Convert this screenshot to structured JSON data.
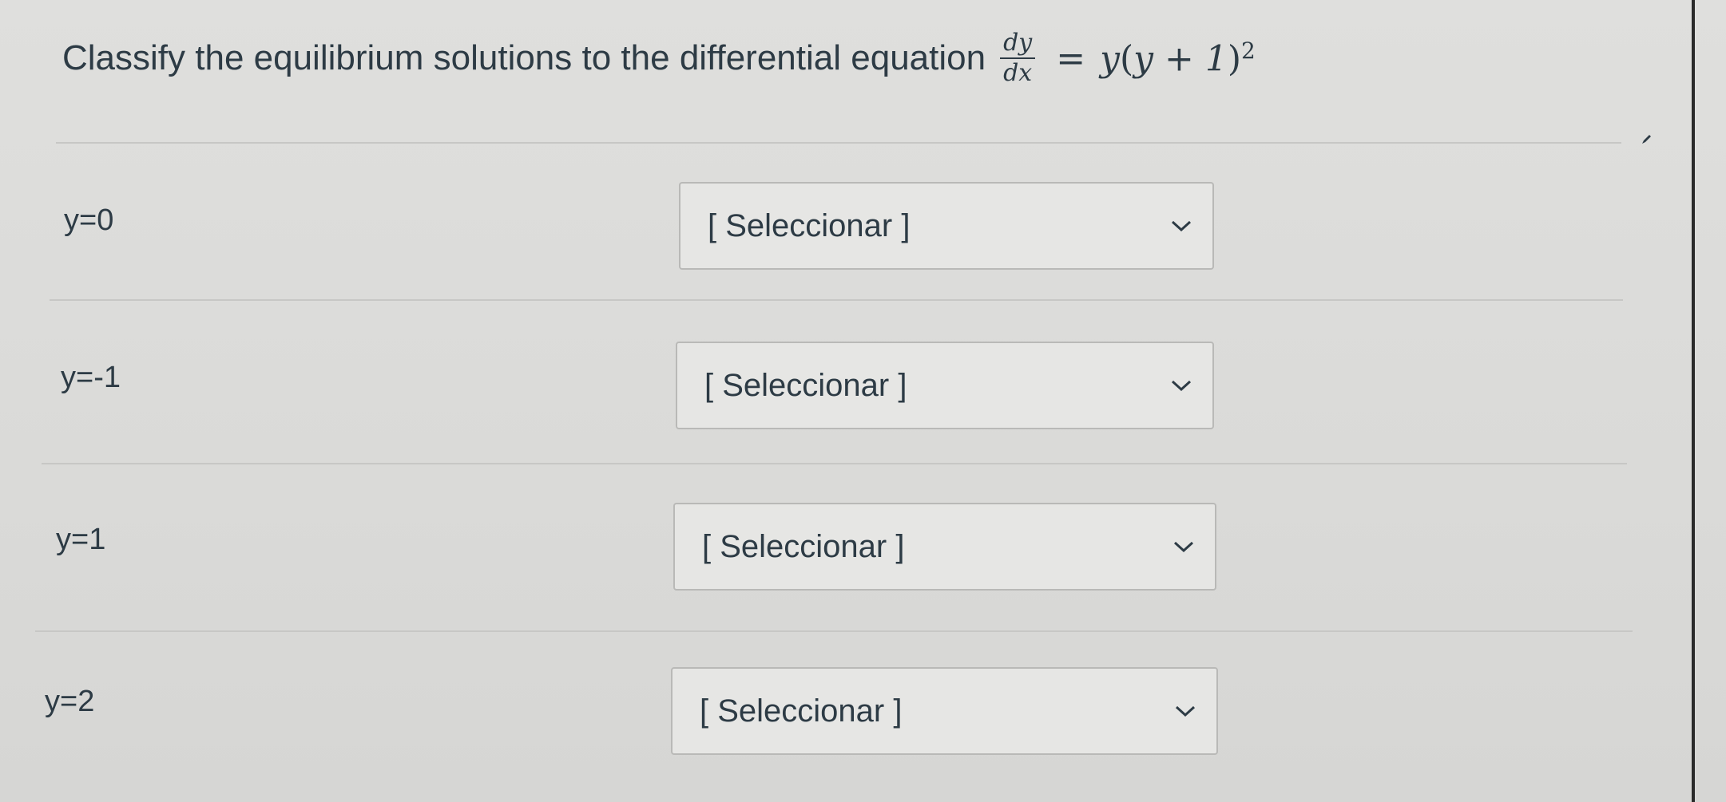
{
  "question": {
    "text": "Classify the equilibrium solutions to the differential equation",
    "equation": {
      "numerator": "dy",
      "denominator": "dx",
      "equals": "=",
      "rhs_y": "y",
      "rhs_open": "(",
      "rhs_inner": "y + 1",
      "rhs_close": ")",
      "rhs_exponent": "2"
    }
  },
  "rows": [
    {
      "label": "y=0",
      "select_value": "[ Seleccionar ]"
    },
    {
      "label": "y=-1",
      "select_value": "[ Seleccionar ]"
    },
    {
      "label": "y=1",
      "select_value": "[ Seleccionar ]"
    },
    {
      "label": "y=2",
      "select_value": "[ Seleccionar ]"
    }
  ],
  "icons": {
    "dropdown": "chevron-down-icon",
    "edit": "pencil-icon"
  },
  "colors": {
    "text": "#2d3b45",
    "background": "#dcdcda",
    "select_border": "#b9b9b7",
    "divider": "#c7c7c5"
  }
}
